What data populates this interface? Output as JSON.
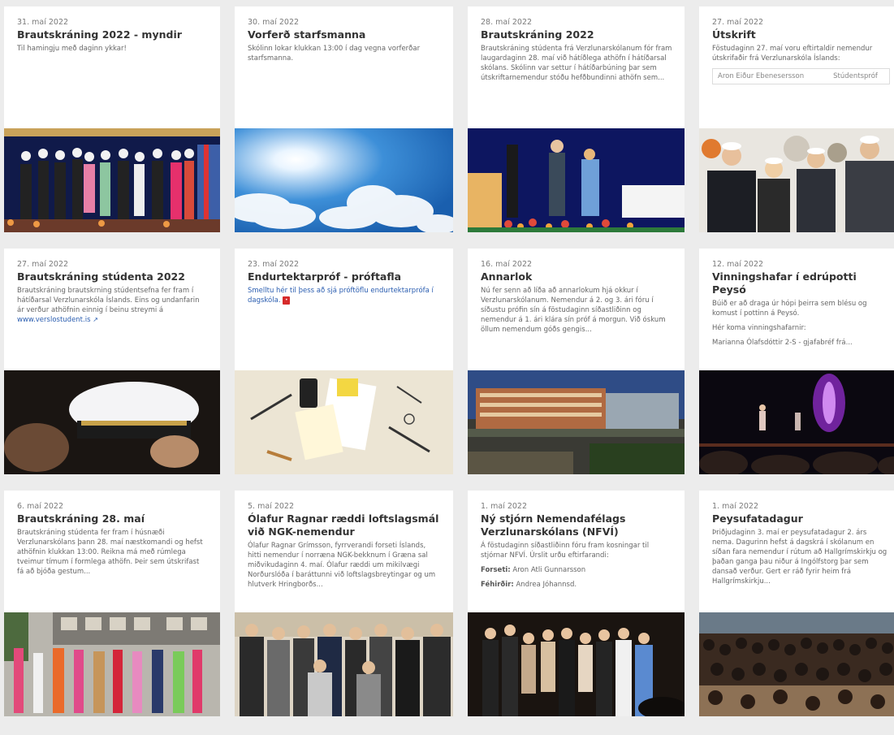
{
  "cards": [
    {
      "date": "31. maí 2022",
      "title": "Brautskráning 2022 - myndir",
      "excerpt": "Til hamingju með daginn ykkar!",
      "image": "graduation-stage-photo"
    },
    {
      "date": "30. maí 2022",
      "title": "Vorferð starfsmanna",
      "excerpt": "Skólinn lokar klukkan 13:00 í dag vegna vorferðar starfsmanna.",
      "image": "sunny-sky-photo"
    },
    {
      "date": "28. maí 2022",
      "title": "Brautskráning 2022",
      "excerpt": "Brautskráning stúdenta frá Verzlunarskólanum fór fram laugardaginn 28. maí við hátíðlega athöfn í hátíðarsal skólans. Skólinn var settur í hátíðarbúning þar sem útskriftarnemendur stóðu hefðbundinni athöfn sem...",
      "image": "diploma-handover-photo"
    },
    {
      "date": "27. maí 2022",
      "title": "Útskrift",
      "excerpt": "Föstudaginn 27. maí voru eftirtaldir nemendur útskrifaðir frá Verzlunarskóla Íslands:",
      "table": {
        "name": "Aron Eiður Ebenesersson",
        "type": "Stúdentspróf"
      },
      "image": "graduates-portrait-photo"
    },
    {
      "date": "27. maí 2022",
      "title": "Brautskráning stúdenta 2022",
      "excerpt": "Brautskráning brautskrning stúdentsefna fer fram í hátíðarsal Verzlunarskóla Íslands. Eins og undanfarin ár verður athöfnin einnig í beinu streymi á",
      "link": "www.verslostudent.is",
      "image": "student-cap-photo"
    },
    {
      "date": "23. maí 2022",
      "title": "Endurtektarpróf - próftafla",
      "excerpt": "Smelltu hér til þess að sjá próftöflu endurtektarprófa í dagskóla.",
      "image": "school-supplies-photo"
    },
    {
      "date": "16. maí 2022",
      "title": "Annarlok",
      "excerpt": "Nú fer senn að líða að annarlokum hjá okkur í Verzlunarskólanum. Nemendur á 2. og 3. ári fóru í síðustu prófin sín á föstudaginn síðastliðinn og nemendur á 1. ári klára sín próf á morgun. Við óskum öllum nemendum góðs gengis...",
      "image": "school-building-photo"
    },
    {
      "date": "12. maí 2022",
      "title": "Vinningshafar í edrúpotti Peysó",
      "excerpt": "Búið er að draga úr hópi þeirra sem blésu og komust í pottinn á Peysó.",
      "excerpt2": "Hér koma vinningshafarnir:",
      "excerpt3": "Marianna Ólafsdóttir 2-S - gjafabréf frá...",
      "image": "concert-stage-photo"
    },
    {
      "date": "6. maí 2022",
      "title": "Brautskráning 28. maí",
      "excerpt": "Brautskráning stúdenta fer fram í húsnæði Verzlunarskólans þann 28. maí næstkomandi og hefst athöfnin klukkan 13:00. Reikna má með rúmlega tveimur tímum í formlega athöfn. Þeir sem útskrifast fá að bjóða gestum...",
      "image": "celebration-street-photo"
    },
    {
      "date": "5. maí 2022",
      "title": "Ólafur Ragnar ræddi loftslagsmál við NGK-nemendur",
      "excerpt": "Ólafur Ragnar Grímsson, fyrrverandi forseti Íslands, hitti nemendur í norræna NGK-bekknum í Græna sal miðvikudaginn 4. maí. Ólafur ræddi um mikilvægi Norðurslóða í baráttunni við loftslagsbreytingar og um hlutverk Hringborðs...",
      "image": "group-photo"
    },
    {
      "date": "1. maí 2022",
      "title": "Ný stjórn Nemendafélags Verzlunarskólans (NFVÍ)",
      "excerpt": "Á föstudaginn síðastliðinn fóru fram kosningar til stjórnar NFVÍ. Úrslit urðu eftirfarandi:",
      "label": "Forseti:",
      "value": "Aron Atli Gunnarsson",
      "label2": "Féhirðir:",
      "value2": "Andrea Jóhannsd.",
      "image": "student-council-photo"
    },
    {
      "date": "1. maí 2022",
      "title": "Peysufatadagur",
      "excerpt": "Þriðjudaginn 3. maí er peysufatadagur 2. árs nema. Dagurinn hefst á dagskrá í skólanum en síðan fara nemendur í rútum að Hallgrímskirkju og þaðan ganga þau niður á Ingólfstorg þar sem dansað verður. Gert er ráð fyrir heim frá Hallgrímskirkju...",
      "image": "dance-crowd-photo"
    }
  ],
  "colors": {
    "link": "#2a5db0",
    "pdf": "#d62a2a",
    "title": "#333333"
  }
}
